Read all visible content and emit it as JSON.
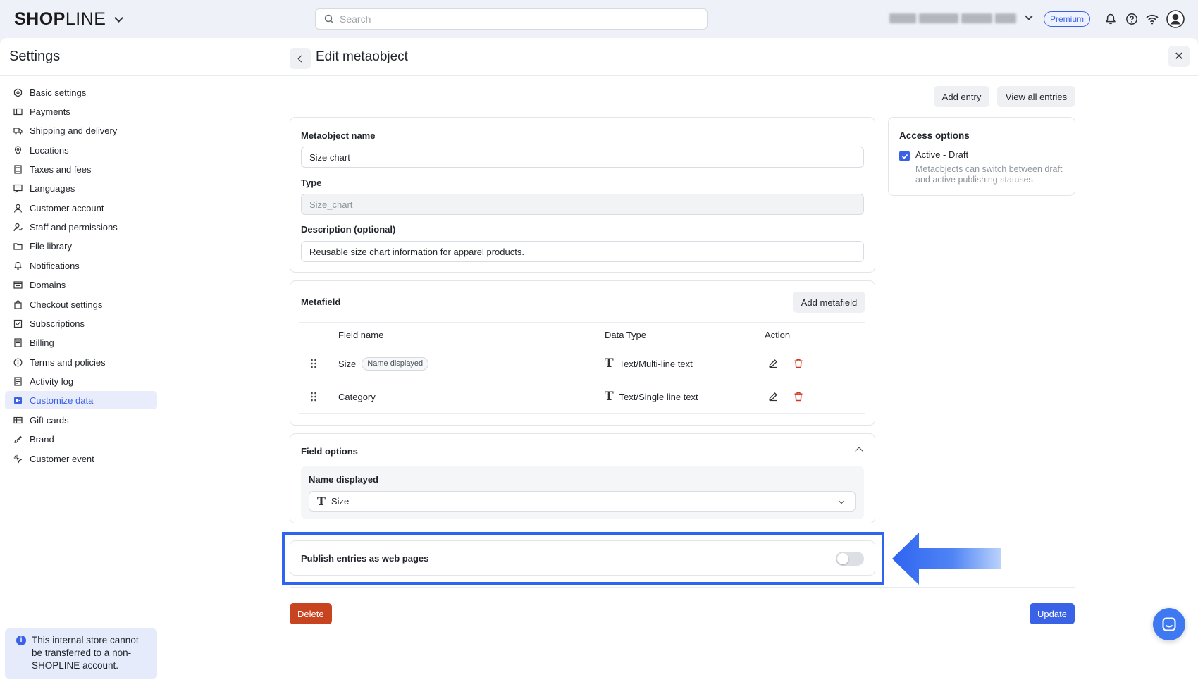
{
  "topbar": {
    "logo_bold": "SHOP",
    "logo_light": "LINE",
    "search_placeholder": "Search",
    "plan_badge": "Premium"
  },
  "panel": {
    "title": "Settings"
  },
  "sidebar": {
    "items": [
      {
        "label": "Basic settings",
        "icon": "store-icon"
      },
      {
        "label": "Payments",
        "icon": "payment-icon"
      },
      {
        "label": "Shipping and delivery",
        "icon": "truck-icon"
      },
      {
        "label": "Locations",
        "icon": "location-pin-icon"
      },
      {
        "label": "Taxes and fees",
        "icon": "tax-icon"
      },
      {
        "label": "Languages",
        "icon": "language-icon"
      },
      {
        "label": "Customer account",
        "icon": "user-icon"
      },
      {
        "label": "Staff and permissions",
        "icon": "staff-icon"
      },
      {
        "label": "File library",
        "icon": "folder-icon"
      },
      {
        "label": "Notifications",
        "icon": "bell-icon"
      },
      {
        "label": "Domains",
        "icon": "domain-icon"
      },
      {
        "label": "Checkout settings",
        "icon": "bag-icon"
      },
      {
        "label": "Subscriptions",
        "icon": "subscription-icon"
      },
      {
        "label": "Billing",
        "icon": "billing-icon"
      },
      {
        "label": "Terms and policies",
        "icon": "info-icon"
      },
      {
        "label": "Activity log",
        "icon": "log-icon"
      },
      {
        "label": "Customize data",
        "icon": "data-icon",
        "active": true
      },
      {
        "label": "Gift cards",
        "icon": "gift-card-icon"
      },
      {
        "label": "Brand",
        "icon": "brand-icon"
      },
      {
        "label": "Customer event",
        "icon": "cursor-icon"
      }
    ],
    "notice": "This internal store cannot be transferred to a non-SHOPLINE account."
  },
  "page": {
    "title": "Edit metaobject",
    "add_entry": "Add entry",
    "view_all_entries": "View all entries"
  },
  "details": {
    "name_label": "Metaobject name",
    "name_value": "Size chart",
    "type_label": "Type",
    "type_value": "Size_chart",
    "desc_label": "Description (optional)",
    "desc_value": "Reusable size chart information for apparel products."
  },
  "access": {
    "title": "Access options",
    "checkbox_label": "Active - Draft",
    "checked": true,
    "help": "Metaobjects can switch between draft and active publishing statuses"
  },
  "metafield": {
    "title": "Metafield",
    "add_button": "Add metafield",
    "columns": [
      "Field name",
      "Data Type",
      "Action"
    ],
    "rows": [
      {
        "name": "Size",
        "badge": "Name displayed",
        "type": "Text/Multi-line text"
      },
      {
        "name": "Category",
        "badge": "",
        "type": "Text/Single line text"
      }
    ]
  },
  "field_options": {
    "title": "Field options",
    "name_displayed_label": "Name displayed",
    "name_displayed_value": "Size"
  },
  "publish": {
    "label": "Publish entries as web pages",
    "enabled": false
  },
  "footer": {
    "delete": "Delete",
    "update": "Update"
  },
  "colors": {
    "accent": "#3a62e6",
    "danger": "#c8431f",
    "highlight": "#2f64f0"
  }
}
